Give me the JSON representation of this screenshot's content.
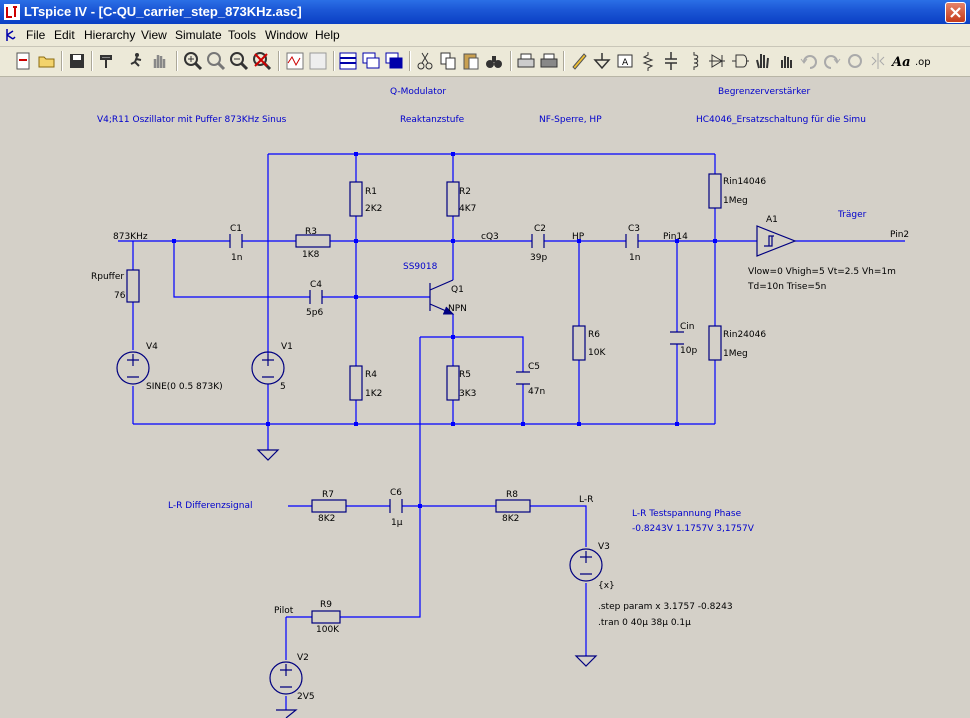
{
  "window": {
    "title": "LTspice IV - [C-QU_carrier_step_873KHz.asc]"
  },
  "menu": [
    "File",
    "Edit",
    "Hierarchy",
    "View",
    "Simulate",
    "Tools",
    "Window",
    "Help"
  ],
  "comments": {
    "qmod": "Q-Modulator",
    "begr": "Begrenzerverstärker",
    "osc": "V4;R11 Oszillator mit Puffer 873KHz Sinus",
    "reakt": "Reaktanzstufe",
    "nf": "NF-Sperre, HP",
    "hc": "HC4046_Ersatzschaltung für die Simu",
    "lr_diff": "L-R Differenzsignal",
    "lr_test": "L-R Testspannung Phase",
    "lr_vals": "-0.8243V 1.1757V  3,1757V",
    "traeger": "Träger"
  },
  "netlabels": {
    "n873": "873KHz",
    "cq3": "cQ3",
    "hp": "HP",
    "pin14": "Pin14",
    "pin2": "Pin2",
    "lr": "L-R",
    "pilot": "Pilot"
  },
  "components": {
    "c1": {
      "name": "C1",
      "value": "1n"
    },
    "r3": {
      "name": "R3",
      "value": "1K8"
    },
    "rpuffer": {
      "name": "Rpuffer",
      "value": "76"
    },
    "v4": {
      "name": "V4",
      "value": "SINE(0 0.5 873K)"
    },
    "v1": {
      "name": "V1",
      "value": "5"
    },
    "r1": {
      "name": "R1",
      "value": "2K2"
    },
    "r2": {
      "name": "R2",
      "value": "4K7"
    },
    "c4": {
      "name": "C4",
      "value": "5p6"
    },
    "q1": {
      "name": "Q1",
      "model": "NPN",
      "part": "SS9018"
    },
    "r4": {
      "name": "R4",
      "value": "1K2"
    },
    "r5": {
      "name": "R5",
      "value": "3K3"
    },
    "c5": {
      "name": "C5",
      "value": "47n"
    },
    "c2": {
      "name": "C2",
      "value": "39p"
    },
    "r6": {
      "name": "R6",
      "value": "10K"
    },
    "c3": {
      "name": "C3",
      "value": "1n"
    },
    "cin": {
      "name": "Cin",
      "value": "10p"
    },
    "rin1": {
      "name": "Rin14046",
      "value": "1Meg"
    },
    "rin2": {
      "name": "Rin24046",
      "value": "1Meg"
    },
    "a1": {
      "name": "A1",
      "params1": "Vlow=0 Vhigh=5 Vt=2.5 Vh=1m",
      "params2": "Td=10n Trise=5n"
    },
    "r7": {
      "name": "R7",
      "value": "8K2"
    },
    "c6": {
      "name": "C6",
      "value": "1µ"
    },
    "r8": {
      "name": "R8",
      "value": "8K2"
    },
    "v3": {
      "name": "V3",
      "value": "{x}"
    },
    "r9": {
      "name": "R9",
      "value": "100K"
    },
    "v2": {
      "name": "V2",
      "value": "2V5"
    }
  },
  "directives": {
    "step": ".step param x 3.1757 -0.8243",
    "tran": ".tran 0 40µ 38µ 0.1µ"
  }
}
